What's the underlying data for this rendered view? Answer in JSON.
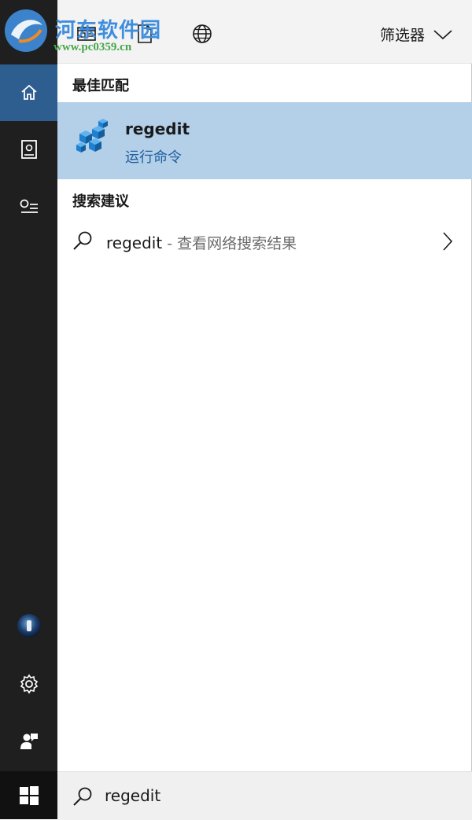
{
  "watermark": {
    "title": "河东软件园",
    "url": "www.pc0359.cn"
  },
  "toolbar": {
    "icons": [
      "apps-icon",
      "document-icon",
      "web-icon"
    ],
    "filter_label": "筛选器"
  },
  "sections": {
    "best_match": "最佳匹配",
    "suggestions": "搜索建议"
  },
  "best_match": {
    "name": "regedit",
    "subtitle": "运行命令",
    "icon": "registry-editor-icon"
  },
  "suggestion": {
    "term": "regedit",
    "hint": " - 查看网络搜索结果"
  },
  "search": {
    "value": "regedit"
  },
  "rail": {
    "items": [
      "home-icon",
      "notebook-icon",
      "reminders-icon",
      "user-avatar",
      "settings-icon",
      "feedback-icon"
    ],
    "active": "home-icon"
  },
  "colors": {
    "rail_bg": "#1f1f1f",
    "rail_active": "#2e5d8f",
    "best_match_bg": "#b4cfe8",
    "subtitle_blue": "#1f5f9e",
    "toolbar_bg": "#f3f3f3"
  }
}
